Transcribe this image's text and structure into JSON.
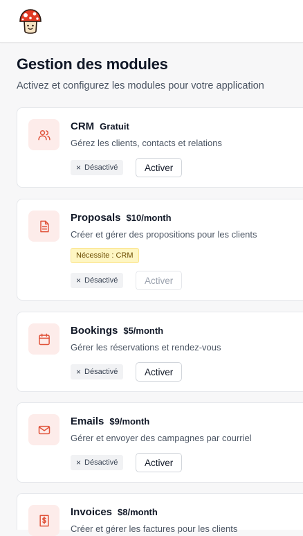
{
  "page": {
    "title": "Gestion des modules",
    "subtitle": "Activez et configurez les modules pour votre application"
  },
  "modules": [
    {
      "name": "CRM",
      "price": "Gratuit",
      "description": "Gérez les clients, contacts et relations",
      "status": "Désactivé",
      "action": "Activer",
      "icon": "users-icon"
    },
    {
      "name": "Proposals",
      "price": "$10/month",
      "description": "Créer et gérer des propositions pour les clients",
      "requirement": "Nécessite : CRM",
      "status": "Désactivé",
      "action": "Activer",
      "action_disabled": true,
      "icon": "document-icon"
    },
    {
      "name": "Bookings",
      "price": "$5/month",
      "description": "Gérer les réservations et rendez-vous",
      "status": "Désactivé",
      "action": "Activer",
      "icon": "calendar-icon"
    },
    {
      "name": "Emails",
      "price": "$9/month",
      "description": "Gérer et envoyer des campagnes par courriel",
      "status": "Désactivé",
      "action": "Activer",
      "icon": "mail-icon"
    },
    {
      "name": "Invoices",
      "price": "$8/month",
      "description": "Créer et gérer les factures pour les clients",
      "icon": "invoice-icon"
    }
  ],
  "colors": {
    "accent": "#e0533a",
    "icon_bg": "#fdecea",
    "requirement_bg": "#fef6c3"
  },
  "logo_icon": "mushroom-logo-icon"
}
